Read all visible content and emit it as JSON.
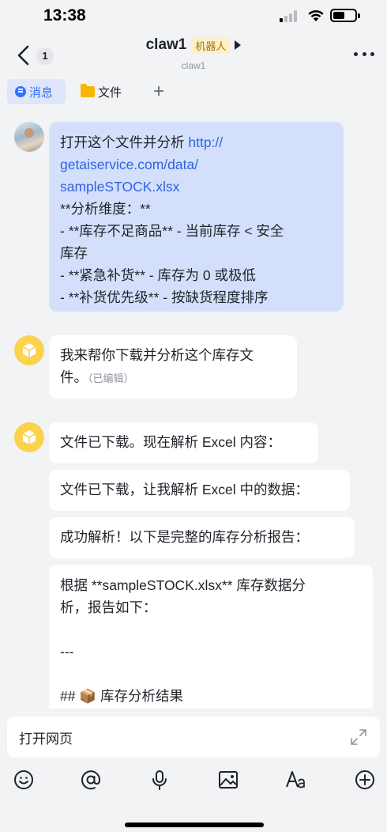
{
  "status_bar": {
    "time": "13:38"
  },
  "header": {
    "back_badge": "1",
    "title": "claw1",
    "bot_tag": "机器人",
    "subtitle": "claw1"
  },
  "tabs": [
    {
      "label": "消息",
      "icon": "chat-bubble-icon",
      "active": true
    },
    {
      "label": "文件",
      "icon": "folder-icon"
    },
    {
      "label": "+",
      "icon": "add-icon"
    }
  ],
  "messages": {
    "user": {
      "line1": "打开这个文件并分析 ",
      "link": "http://getaiservice.com/data/sampleSTOCK.xlsx",
      "link_lines": [
        "http://",
        "getaiservice.com/data/",
        "sampleSTOCK.xlsx"
      ],
      "lines": [
        "**分析维度：**",
        "- **库存不足商品** - 当前库存 < 安全",
        "库存",
        "- **紧急补货** - 库存为 0 或极低",
        "- **补货优先级** - 按缺货程度排序"
      ]
    },
    "bot_reply_1": {
      "text_line1": "我来帮你下载并分析这个库存文",
      "text_line2": "件。",
      "edited_label": "（已编辑）"
    },
    "bot_reply_2": [
      "文件已下载。现在解析 Excel 内容：",
      "文件已下载，让我解析 Excel 中的数据：",
      "成功解析！以下是完整的库存分析报告："
    ],
    "report": {
      "line1": "根据 **sampleSTOCK.xlsx** 库存数据分",
      "line2": "析，报告如下：",
      "line3": "---",
      "line4_prefix": "## ",
      "line4_icon": "📦",
      "line4_text": " 库存分析结果"
    }
  },
  "input": {
    "text": "打开网页"
  },
  "toolbar": [
    "emoji-icon",
    "mention-icon",
    "microphone-icon",
    "image-icon",
    "text-format-icon",
    "plus-circle-icon"
  ],
  "colors": {
    "accent": "#3370ff",
    "user_bubble": "#d4e0fb",
    "bot_avatar": "#fbd24e",
    "background": "#f2f3f5"
  }
}
